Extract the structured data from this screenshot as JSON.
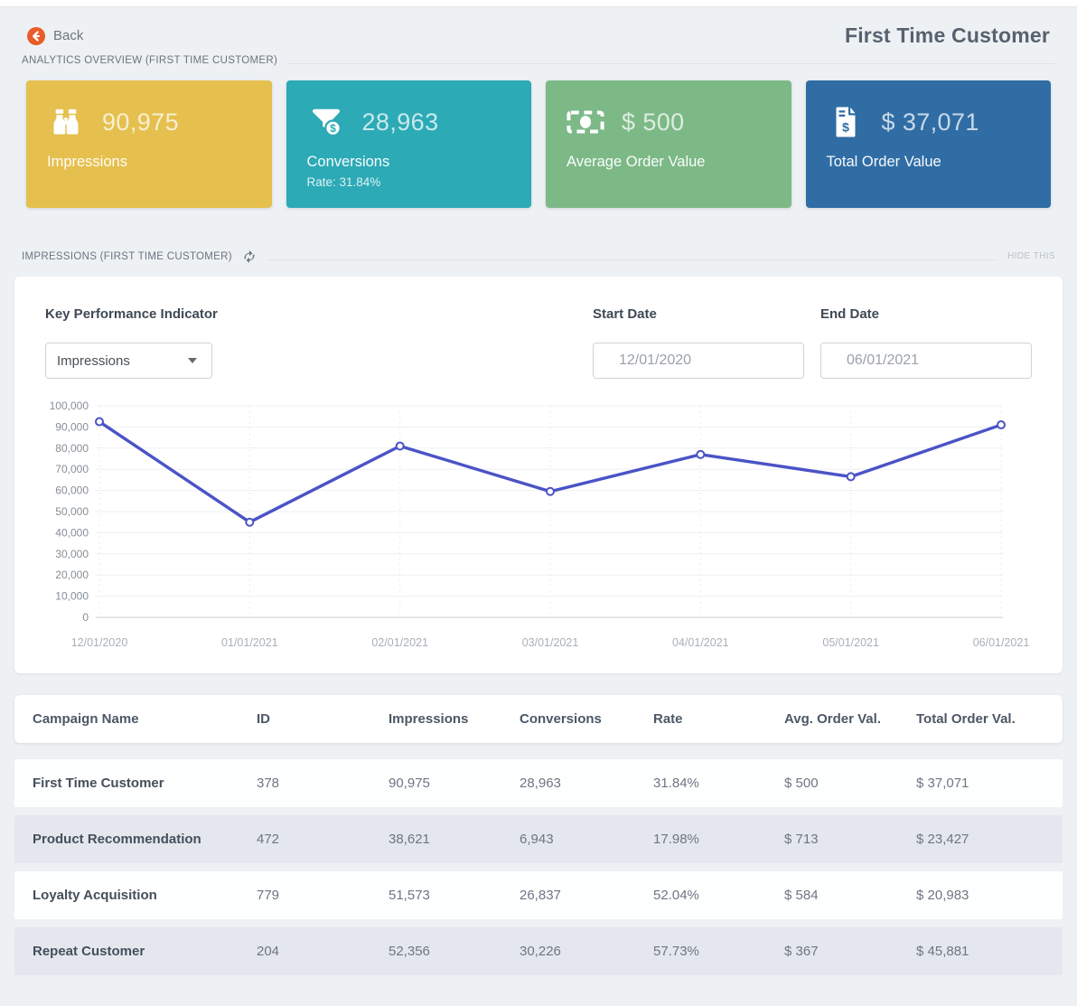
{
  "header": {
    "back_label": "Back",
    "page_title": "First Time Customer"
  },
  "overview_section": {
    "label": "ANALYTICS OVERVIEW (FIRST TIME CUSTOMER)"
  },
  "stat_cards": [
    {
      "value": "90,975",
      "label": "Impressions",
      "sub": "",
      "color": "#e5c04e",
      "icon": "binoculars-icon"
    },
    {
      "value": "28,963",
      "label": "Conversions",
      "sub": "Rate: 31.84%",
      "color": "#2caab6",
      "icon": "funnel-dollar-icon"
    },
    {
      "value": "$ 500",
      "label": "Average Order Value",
      "sub": "",
      "color": "#7cb987",
      "icon": "money-bill-icon"
    },
    {
      "value": "$ 37,071",
      "label": "Total Order Value",
      "sub": "",
      "color": "#2f6da4",
      "icon": "file-invoice-dollar-icon"
    }
  ],
  "impressions_section": {
    "label": "IMPRESSIONS (FIRST TIME CUSTOMER)",
    "hide_label": "HIDE THIS"
  },
  "controls": {
    "kpi_label": "Key Performance Indicator",
    "kpi_selected": "Impressions",
    "start_date_label": "Start Date",
    "start_date_value": "12/01/2020",
    "end_date_label": "End Date",
    "end_date_value": "06/01/2021"
  },
  "chart_data": {
    "type": "line",
    "x": [
      "12/01/2020",
      "01/01/2021",
      "02/01/2021",
      "03/01/2021",
      "04/01/2021",
      "05/01/2021",
      "06/01/2021"
    ],
    "series": [
      {
        "name": "Impressions",
        "values": [
          92500,
          45000,
          81000,
          59500,
          77000,
          66500,
          91000
        ]
      }
    ],
    "ylim": [
      0,
      100000
    ],
    "ytick_step": 10000,
    "grid": true,
    "legend": false,
    "line_color": "#4a53c6"
  },
  "table": {
    "columns": [
      "Campaign Name",
      "ID",
      "Impressions",
      "Conversions",
      "Rate",
      "Avg. Order Val.",
      "Total Order Val."
    ],
    "rows": [
      [
        "First Time Customer",
        "378",
        "90,975",
        "28,963",
        "31.84%",
        "$ 500",
        "$ 37,071"
      ],
      [
        "Product Recommendation",
        "472",
        "38,621",
        "6,943",
        "17.98%",
        "$ 713",
        "$ 23,427"
      ],
      [
        "Loyalty Acquisition",
        "779",
        "51,573",
        "26,837",
        "52.04%",
        "$ 584",
        "$ 20,983"
      ],
      [
        "Repeat Customer",
        "204",
        "52,356",
        "30,226",
        "57.73%",
        "$ 367",
        "$ 45,881"
      ]
    ]
  }
}
